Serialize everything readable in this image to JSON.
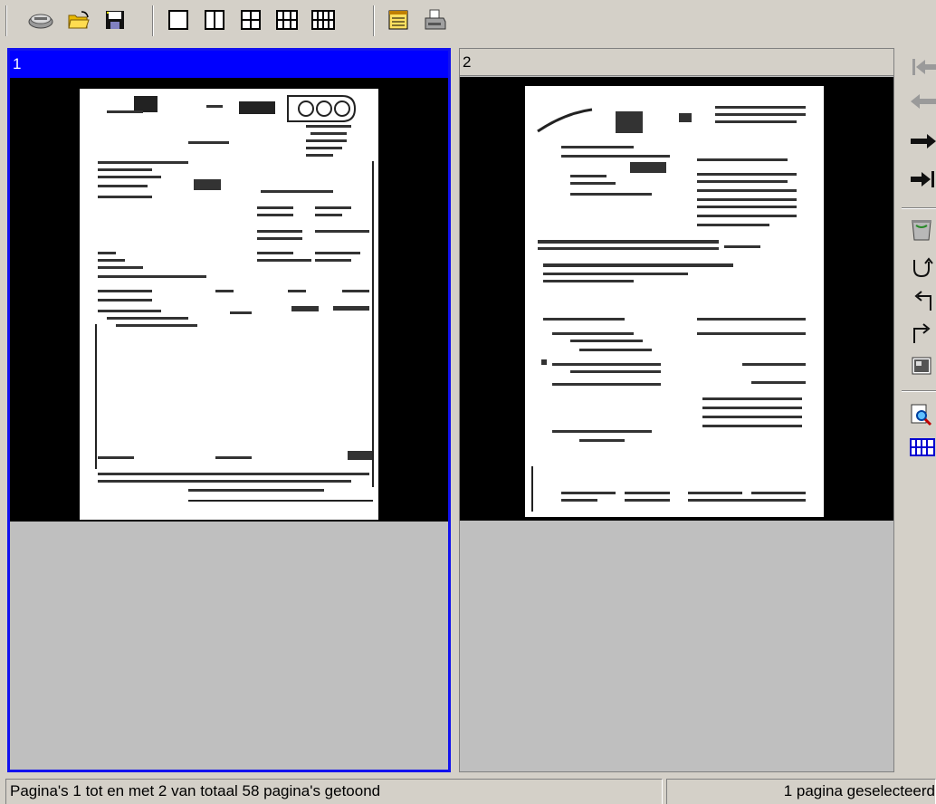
{
  "toolbar": {
    "icons": [
      "scan-icon",
      "open-folder-icon",
      "save-icon",
      "layout-1-icon",
      "layout-2-icon",
      "layout-4-icon",
      "layout-6-icon",
      "layout-8-icon",
      "notepad-icon",
      "printer-icon"
    ]
  },
  "panes": [
    {
      "label": "1",
      "selected": true
    },
    {
      "label": "2",
      "selected": false
    }
  ],
  "sidebar": {
    "icons": [
      "first-page-icon",
      "previous-page-icon",
      "next-page-icon",
      "last-page-icon",
      "recycle-bin-icon",
      "rotate-180-icon",
      "rotate-left-icon",
      "rotate-right-icon",
      "image-icon",
      "zoom-page-icon",
      "grid-view-icon"
    ]
  },
  "status": {
    "left": "Pagina's 1 tot en met 2 van totaal 58 pagina's getoond",
    "right": "1 pagina geselecteerd"
  },
  "colors": {
    "selection": "#0000ff",
    "chrome": "#d4d0c8",
    "pane_background": "#bfbfbf"
  }
}
